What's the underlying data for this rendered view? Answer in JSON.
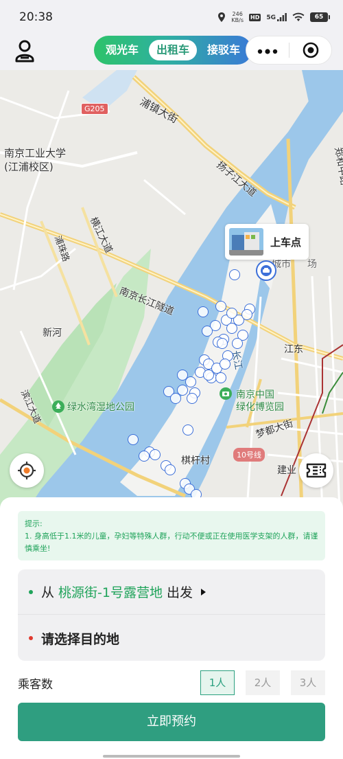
{
  "status_bar": {
    "time": "20:38",
    "net_speed_value": "246",
    "net_speed_unit": "KB/s",
    "hd": "HD",
    "signal": "5G",
    "battery": "65"
  },
  "header": {
    "tabs": [
      {
        "label": "观光车",
        "active": false
      },
      {
        "label": "出租车",
        "active": true
      },
      {
        "label": "接驳车",
        "active": false
      }
    ]
  },
  "map": {
    "labels": {
      "pujin_street": "浦镇大街",
      "g205": "G205",
      "nju_tech_1": "南京工业大学",
      "nju_tech_2": "(江浦校区)",
      "puzhu_road": "浦珠路",
      "hengjiang_avenue": "横江大道",
      "binjiang_avenue": "滨江大道",
      "tunnel": "南京长江隧道",
      "xinhe": "新河",
      "wetland_park": "绿水湾湿地公园",
      "yangtze": "长江",
      "expo_1": "南京中国",
      "expo_2": "绿化博览园",
      "qiganchun": "棋杆村",
      "line10": "10号线",
      "mengdu_street": "梦都大街",
      "jiangdong": "江东",
      "jianye": "建业",
      "zhengzhong_road": "郑和中路",
      "city_partial": "城市",
      "chang_partial": "场",
      "yangtze_bridge": "扬子江大道"
    },
    "pickup_label": "上车点",
    "vehicle_count": 42
  },
  "notice": {
    "title": "提示:",
    "body": "1. 身高低于1.1米的儿童，孕妇等特殊人群，行动不便或正在使用医学支架的人群，请谨慎乘坐!"
  },
  "route": {
    "from_prefix": "从",
    "from_place": "桃源街-1号露营地",
    "from_suffix": "出发",
    "to_placeholder": "请选择目的地"
  },
  "passengers": {
    "label": "乘客数",
    "options": [
      "1人",
      "2人",
      "3人"
    ],
    "selected": "1人"
  },
  "book_button": "立即预约",
  "colors": {
    "accent": "#2f9e80",
    "green_text": "#1fa35a",
    "vehicle": "#3c6fd9",
    "river": "#9cc7ea"
  }
}
